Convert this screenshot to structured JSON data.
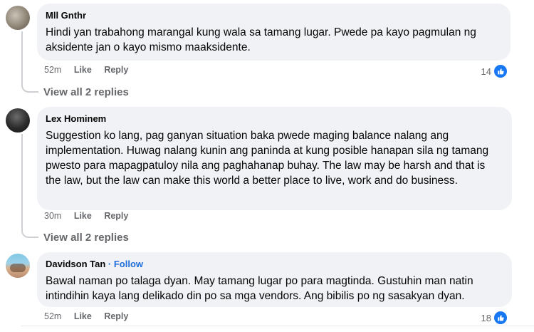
{
  "comments": [
    {
      "author": "Mll Gnthr",
      "follow": "",
      "text": "Hindi yan trabahong marangal kung wala sa tamang lugar. Pwede pa kayo pagmulan ng aksidente jan o kayo mismo maaksidente.",
      "time": "52m",
      "like": "Like",
      "reply": "Reply",
      "reaction_count": "14",
      "view_replies": "View all 2 replies"
    },
    {
      "author": "Lex Hominem",
      "follow": "",
      "text": "Suggestion ko lang, pag ganyan situation baka pwede maging balance nalang ang implementation. Huwag nalang kunin ang paninda at kung posible hanapan sila ng tamang pwesto para mapagpatuloy nila ang paghahanap buhay. The law may be harsh and that is the law, but the law can make this world a better place to live, work and do business.",
      "time": "30m",
      "like": "Like",
      "reply": "Reply",
      "reaction_count": "",
      "view_replies": "View all 2 replies"
    },
    {
      "author": "Davidson Tan",
      "follow": "· Follow",
      "text": "Bawal naman po talaga dyan. May tamang lugar po para magtinda. Gustuhin man natin intindihin kaya lang delikado din po sa mga vendors. Ang bibilis po ng sasakyan dyan.",
      "time": "52m",
      "like": "Like",
      "reply": "Reply",
      "reaction_count": "18",
      "view_replies": ""
    }
  ],
  "colors": {
    "bubble": "#f0f2f5",
    "meta": "#65676b",
    "link": "#216fdb",
    "like_blue": "#1877f2"
  },
  "icons": {
    "reaction": "thumbs-up-icon"
  }
}
